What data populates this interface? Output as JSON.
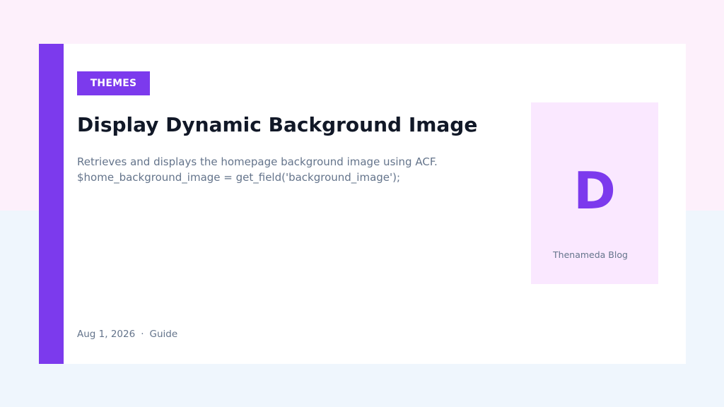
{
  "card": {
    "category": "THEMES",
    "title": "Display Dynamic Background Image",
    "excerpt_lines": [
      "Retrieves and displays the homepage background image using ACF.",
      "$home_background_image = get_field('background_image');"
    ],
    "meta": {
      "date": "Aug 1, 2026",
      "separator": "·",
      "type": "Guide"
    },
    "thumbnail": {
      "letter": "D",
      "caption": "Thenameda Blog"
    }
  },
  "colors": {
    "accent": "#7c3aed",
    "title": "#111827",
    "muted_text": "#64748b",
    "thumbnail_bg": "#fae8ff",
    "page_bg_top": "#fdf0fb",
    "page_bg_bottom": "#eff6fd"
  }
}
